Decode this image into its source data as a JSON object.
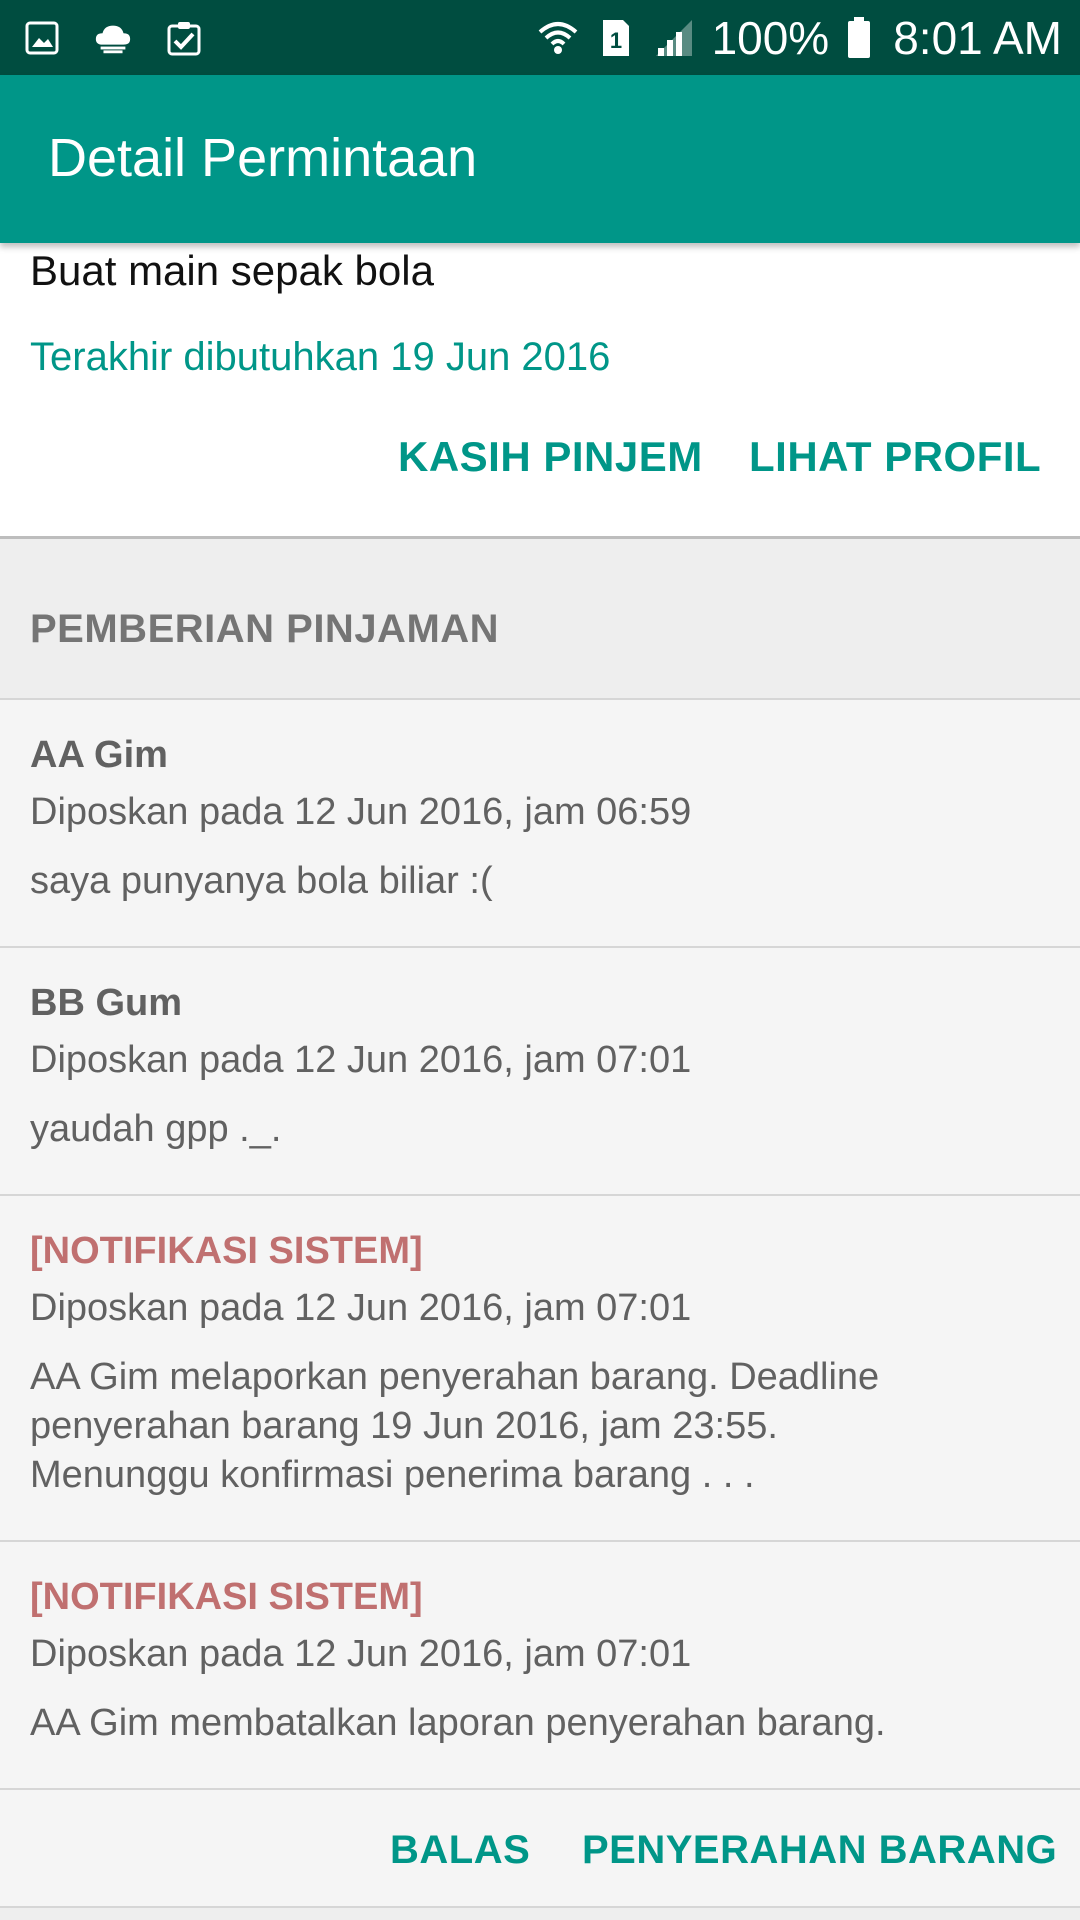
{
  "status_bar": {
    "left_icons": [
      "gallery-icon",
      "cloud-icon",
      "clipboard-check-icon"
    ],
    "right_icons": [
      "wifi-icon",
      "sim-1-icon",
      "signal-icon"
    ],
    "battery": "100%",
    "time": "8:01 AM"
  },
  "app_bar": {
    "title": "Detail Permintaan"
  },
  "request": {
    "description": "Buat main sepak bola",
    "deadline": "Terakhir dibutuhkan 19 Jun 2016",
    "actions": {
      "lend": "KASIH PINJEM",
      "view_profile": "LIHAT PROFIL"
    }
  },
  "section": {
    "title": "PEMBERIAN PINJAMAN"
  },
  "comments": [
    {
      "author": "AA Gim",
      "date": "Diposkan pada 12 Jun 2016, jam 06:59",
      "body": "saya punyanya bola biliar :("
    },
    {
      "author": "BB Gum",
      "date": "Diposkan pada 12 Jun 2016, jam 07:01",
      "body": "yaudah gpp ._."
    },
    {
      "author": "[NOTIFIKASI SISTEM]",
      "date": "Diposkan pada 12 Jun 2016, jam 07:01",
      "body": "AA Gim melaporkan penyerahan barang. Deadline\npenyerahan barang 19 Jun 2016, jam 23:55.\nMenunggu konfirmasi penerima barang . . ."
    },
    {
      "author": "[NOTIFIKASI SISTEM]",
      "date": "Diposkan pada 12 Jun 2016, jam 07:01",
      "body": "AA Gim membatalkan laporan penyerahan barang."
    }
  ],
  "bottom_actions": {
    "reply": "BALAS",
    "handover": "PENYERAHAN BARANG"
  },
  "colors": {
    "primary": "#009688",
    "primary_dark": "#004d40",
    "system_author": "#c07070",
    "text_secondary": "#616161"
  }
}
